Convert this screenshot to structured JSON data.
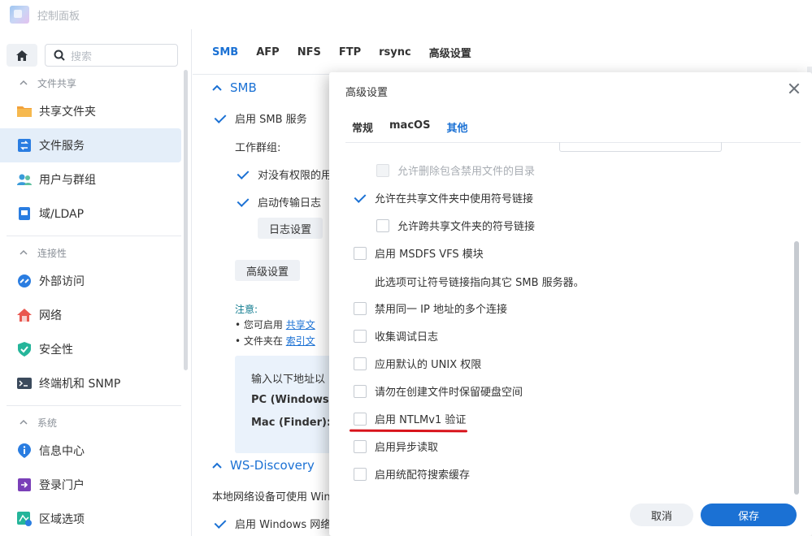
{
  "app": {
    "title": "控制面板"
  },
  "sidebar": {
    "search_placeholder": "搜索",
    "groups": [
      {
        "label": "文件共享",
        "items": [
          "共享文件夹",
          "文件服务",
          "用户与群组",
          "域/LDAP"
        ]
      },
      {
        "label": "连接性",
        "items": [
          "外部访问",
          "网络",
          "安全性",
          "终端机和 SNMP"
        ]
      },
      {
        "label": "系统",
        "items": [
          "信息中心",
          "登录门户",
          "区域选项"
        ]
      }
    ],
    "active_item": "文件服务"
  },
  "main": {
    "tabs": [
      "SMB",
      "AFP",
      "NFS",
      "FTP",
      "rsync",
      "高级设置"
    ],
    "active_tab": "SMB",
    "smb_section": "SMB",
    "enable_smb": "启用 SMB 服务",
    "workgroup_label": "工作群组:",
    "no_permission": "对没有权限的用",
    "enable_log": "启动传输日志",
    "log_settings_button": "日志设置",
    "advanced_button": "高级设置",
    "note_title": "注意:",
    "note_1_prefix": "您可启用",
    "note_1_link": "共享文",
    "note_2_prefix": "文件夹在",
    "note_2_link": "索引文",
    "info_line": "输入以下地址以",
    "info_pc": "PC (Windows",
    "info_mac": "Mac (Finder):",
    "ws_section": "WS-Discovery",
    "ws_text": "本地网络设备可使用 Win",
    "ws_cb": "启用 Windows 网络"
  },
  "modal": {
    "title": "高级设置",
    "tabs": [
      "常规",
      "macOS",
      "其他"
    ],
    "active_tab": "其他",
    "options": {
      "allow_delete_dirs": {
        "label": "允许删除包含禁用文件的目录",
        "checked": false,
        "disabled": true
      },
      "allow_symlinks": {
        "label": "允许在共享文件夹中使用符号链接",
        "checked": true
      },
      "allow_cross_symlinks": {
        "label": "允许跨共享文件夹的符号链接",
        "checked": false
      },
      "msdfs": {
        "label": "启用 MSDFS VFS 模块",
        "checked": false
      },
      "msdfs_desc": "此选项可让符号链接指向其它 SMB 服务器。",
      "disable_multi_ip": {
        "label": "禁用同一 IP 地址的多个连接",
        "checked": false
      },
      "debug_log": {
        "label": "收集调试日志",
        "checked": false
      },
      "unix_perms": {
        "label": "应用默认的 UNIX 权限",
        "checked": false
      },
      "reserve_disk": {
        "label": "请勿在创建文件时保留硬盘空间",
        "checked": false
      },
      "ntlmv1": {
        "label": "启用 NTLMv1 验证",
        "checked": false
      },
      "async_read": {
        "label": "启用异步读取",
        "checked": false
      },
      "wildcard_cache": {
        "label": "启用统配符搜索缓存",
        "checked": false
      }
    },
    "cancel_label": "取消",
    "save_label": "保存"
  },
  "colors": {
    "accent": "#1b71d4",
    "highlight": "#d8131b",
    "note": "#0e7a8e"
  }
}
